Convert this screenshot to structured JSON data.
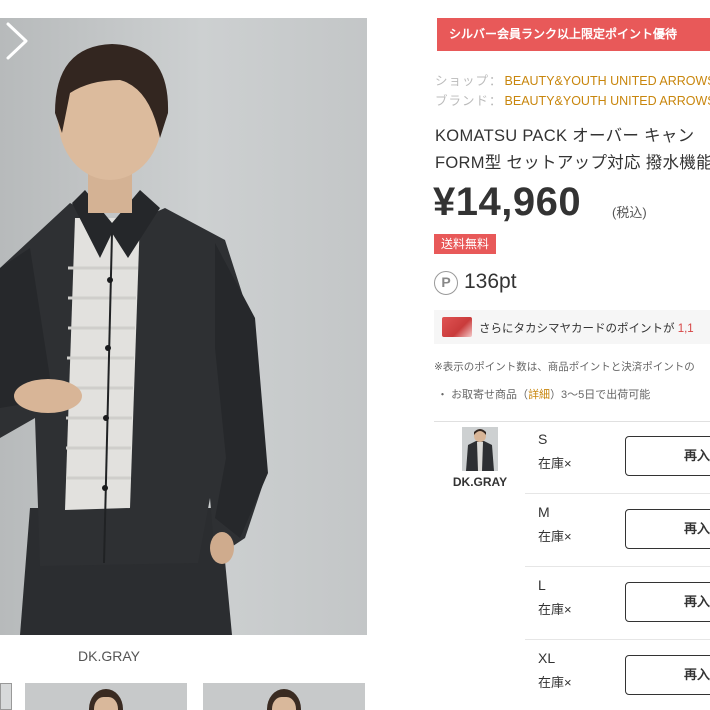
{
  "gallery": {
    "main_image_alt": "jacket-on-model",
    "color_caption": "DK.GRAY",
    "next_icon": "chevron-right-icon"
  },
  "promo": {
    "banner": "シルバー会員ランク以上限定ポイント優待"
  },
  "meta": {
    "shop_key": "ショップ：",
    "shop_value": "BEAUTY&YOUTH UNITED ARROWS",
    "brand_key": "ブランド：",
    "brand_value": "BEAUTY&YOUTH UNITED ARROWS"
  },
  "product": {
    "title_line1": "KOMATSU PACK オーバー キャン",
    "title_line2": "FORM型 セットアップ対応 撥水機能"
  },
  "price": {
    "amount": "¥14,960",
    "tax": "(税込)",
    "shipping": "送料無料"
  },
  "points": {
    "icon_label": "P",
    "value": "136pt"
  },
  "card_offer": {
    "text": "さらにタカシマヤカードのポイントが",
    "value": "1,1"
  },
  "note": "※表示のポイント数は、商品ポイントと決済ポイントの",
  "order": {
    "bullet": "・",
    "pre": "お取寄せ商品（",
    "link": "詳細",
    "post": "）3〜5日で出荷可能"
  },
  "sku": {
    "color_label": "DK.GRAY",
    "sizes": [
      {
        "name": "S",
        "stock": "在庫×",
        "button": "再入"
      },
      {
        "name": "M",
        "stock": "在庫×",
        "button": "再入"
      },
      {
        "name": "L",
        "stock": "在庫×",
        "button": "再入"
      },
      {
        "name": "XL",
        "stock": "在庫×",
        "button": "再入"
      }
    ]
  },
  "colors": {
    "accent_red": "#e85959",
    "link_gold": "#c8860d",
    "jacket": "#2e3033"
  }
}
